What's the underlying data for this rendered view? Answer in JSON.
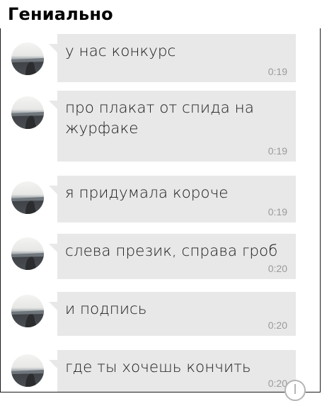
{
  "header": {
    "title": "Гениально"
  },
  "messages": [
    {
      "text": "у нас конкурс",
      "time": "0:19"
    },
    {
      "text": "про плакат от спида на журфаке",
      "time": "0:19"
    },
    {
      "text": "я придумала короче",
      "time": "0:19"
    },
    {
      "text": "слева презик, справа гроб",
      "time": "0:20"
    },
    {
      "text": "и подпись",
      "time": "0:20"
    },
    {
      "text": "где ты хочешь кончить",
      "time": "0:20"
    }
  ],
  "colors": {
    "bubble": "#e8e8e8",
    "timestamp": "#9a9a9a",
    "text": "#1c1c1c"
  },
  "icons": {
    "avatar": "avatar-icon",
    "compose": "compose-button-icon"
  }
}
